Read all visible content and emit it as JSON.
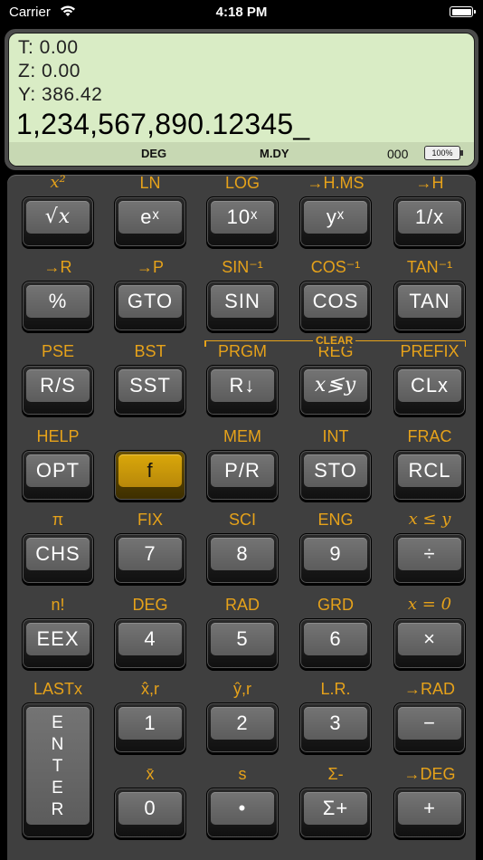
{
  "statusbar": {
    "carrier": "Carrier",
    "time": "4:18 PM"
  },
  "display": {
    "t": "T:  0.00",
    "z": "Z:  0.00",
    "y": "Y:  386.42",
    "x": "1,234,567,890.12345_",
    "angle": "DEG",
    "date_mode": "M.DY",
    "counter": "000",
    "battery": "100%"
  },
  "clear_label": "CLEAR",
  "rows": [
    {
      "keys": [
        {
          "f": "x²",
          "main": "√x",
          "fit": true,
          "mit": true
        },
        {
          "f": "LN",
          "main": "eˣ",
          "mit": false
        },
        {
          "f": "LOG",
          "main": "10ˣ"
        },
        {
          "f": "→H.MS",
          "main": "yˣ"
        },
        {
          "f": "→H",
          "main": "1/x"
        }
      ]
    },
    {
      "keys": [
        {
          "f": "→R",
          "main": "%"
        },
        {
          "f": "→P",
          "main": "GTO"
        },
        {
          "f": "SIN⁻¹",
          "main": "SIN"
        },
        {
          "f": "COS⁻¹",
          "main": "COS"
        },
        {
          "f": "TAN⁻¹",
          "main": "TAN"
        }
      ]
    },
    {
      "keys": [
        {
          "f": "PSE",
          "main": "R/S"
        },
        {
          "f": "BST",
          "main": "SST"
        },
        {
          "f": "PRGM",
          "main": "R↓"
        },
        {
          "f": "REG",
          "main": "x≶y",
          "mit": true
        },
        {
          "f": "PREFIX",
          "main": "CLx"
        }
      ]
    },
    {
      "keys": [
        {
          "f": "HELP",
          "main": "OPT"
        },
        {
          "f": "",
          "main": "f",
          "gold": true
        },
        {
          "f": "MEM",
          "main": "P/R"
        },
        {
          "f": "INT",
          "main": "STO"
        },
        {
          "f": "FRAC",
          "main": "RCL"
        }
      ]
    },
    {
      "keys": [
        {
          "f": "π",
          "main": "CHS"
        },
        {
          "f": "FIX",
          "main": "7"
        },
        {
          "f": "SCI",
          "main": "8"
        },
        {
          "f": "ENG",
          "main": "9"
        },
        {
          "f": "x ≤ y",
          "main": "÷",
          "fit": true
        }
      ]
    },
    {
      "keys": [
        {
          "f": "n!",
          "main": "EEX"
        },
        {
          "f": "DEG",
          "main": "4"
        },
        {
          "f": "RAD",
          "main": "5"
        },
        {
          "f": "GRD",
          "main": "6"
        },
        {
          "f": "x = 0",
          "main": "×",
          "fit": true
        }
      ]
    },
    {
      "keys": [
        {
          "f": "LASTx",
          "main": "E N T E R",
          "enter": true
        },
        {
          "f": "x̂,r",
          "main": "1"
        },
        {
          "f": "ŷ,r",
          "main": "2"
        },
        {
          "f": "L.R.",
          "main": "3"
        },
        {
          "f": "→RAD",
          "main": "−"
        }
      ]
    },
    {
      "keys": [
        {
          "skip": true
        },
        {
          "f": "x̄",
          "main": "0"
        },
        {
          "f": "s",
          "main": "•"
        },
        {
          "f": "Σ-",
          "main": "Σ+"
        },
        {
          "f": "→DEG",
          "main": "+"
        }
      ]
    }
  ]
}
